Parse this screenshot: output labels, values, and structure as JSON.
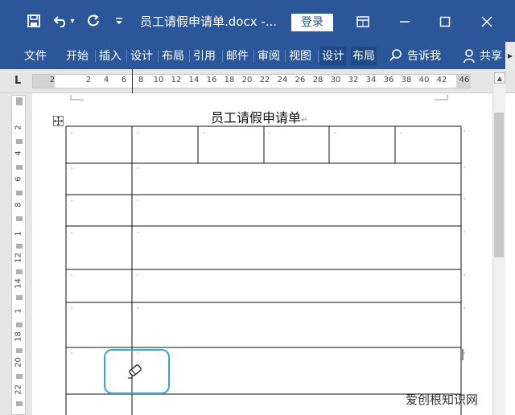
{
  "window": {
    "title": "员工请假申请单.docx  -...",
    "login_label": "登录",
    "qat": {
      "save_icon": "save-icon",
      "undo_icon": "undo-icon",
      "undo_dropdown": "▾",
      "redo_icon": "repeat-icon",
      "customize_icon": "customize-icon"
    },
    "controls": {
      "ribbon_display": "ribbon-display-icon",
      "minimize": "minimize-icon",
      "maximize": "maximize-icon",
      "close": "close-icon"
    }
  },
  "ribbon": {
    "tabs": [
      {
        "label": "文件"
      },
      {
        "label": "开始"
      },
      {
        "label": "插入"
      },
      {
        "label": "设计"
      },
      {
        "label": "布局"
      },
      {
        "label": "引用"
      },
      {
        "label": "邮件"
      },
      {
        "label": "审阅"
      },
      {
        "label": "视图"
      },
      {
        "label": "设计"
      },
      {
        "label": "布局"
      }
    ],
    "tell_me": "告诉我",
    "share": "共享"
  },
  "ruler": {
    "tab_selector": "L",
    "h_numbers": [
      "2",
      "2",
      "4",
      "6",
      "8",
      "10",
      "12",
      "14",
      "16",
      "18",
      "20",
      "22",
      "24",
      "26",
      "28",
      "30",
      "32",
      "34",
      "36",
      "38",
      "40",
      "42",
      "46"
    ],
    "v_numbers": [
      "2",
      "4",
      "6",
      "8",
      "1",
      "12",
      "14",
      "1",
      "18",
      "20",
      "22"
    ]
  },
  "document": {
    "title": "员工请假申请单",
    "paragraph_mark": "↵"
  },
  "watermark": "爱创根知识网"
}
